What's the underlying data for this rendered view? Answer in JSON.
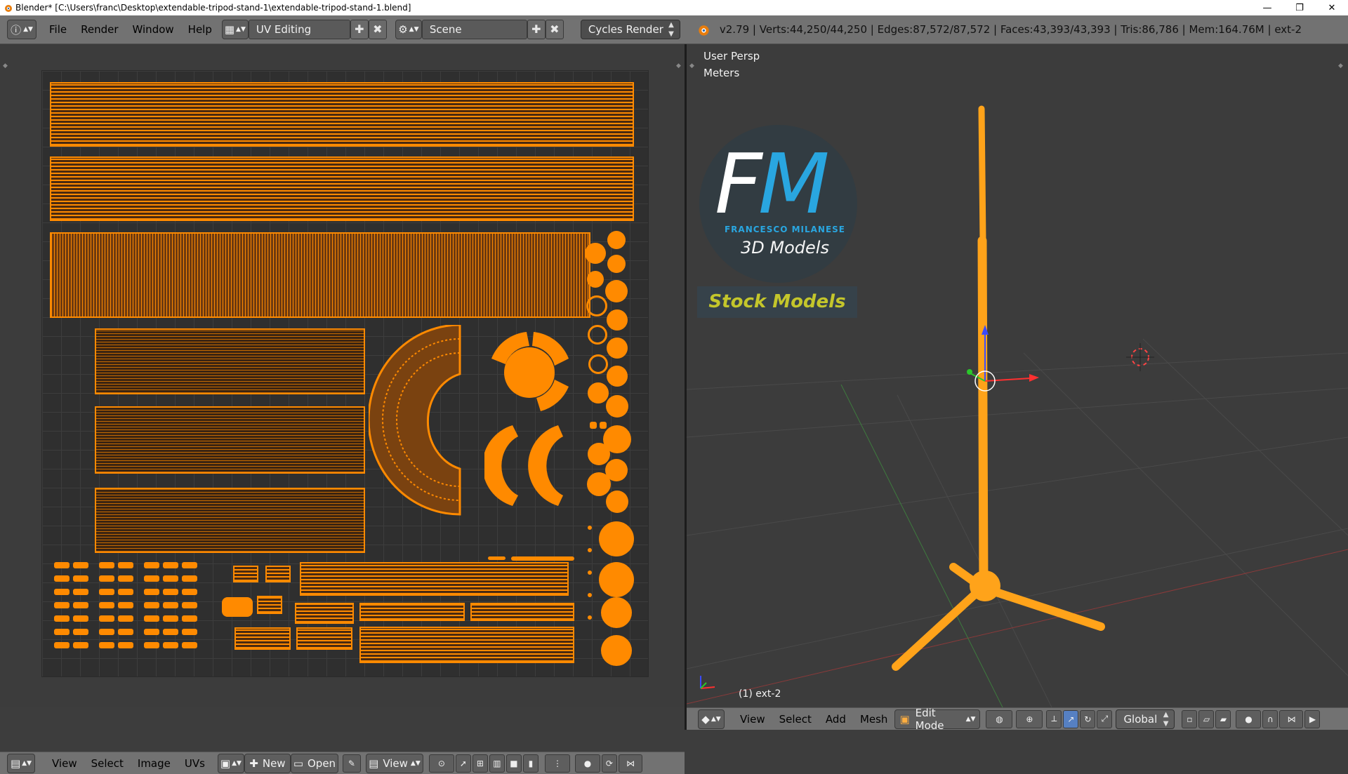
{
  "window": {
    "title": "Blender* [C:\\Users\\franc\\Desktop\\extendable-tripod-stand-1\\extendable-tripod-stand-1.blend]",
    "minimize": "—",
    "restore": "❐",
    "close": "✕"
  },
  "info_header": {
    "menus": [
      "File",
      "Render",
      "Window",
      "Help"
    ],
    "screen_layout": "UV Editing",
    "scene": "Scene",
    "render_engine": "Cycles Render",
    "stats": "v2.79 | Verts:44,250/44,250 | Edges:87,572/87,572 | Faces:43,393/43,393 | Tris:86,786 | Mem:164.76M | ext-2"
  },
  "uv_editor": {
    "header": {
      "menus": [
        "View",
        "Select",
        "Image",
        "UVs"
      ],
      "new_label": "New",
      "open_label": "Open",
      "view_label": "View"
    }
  },
  "viewport": {
    "view_name": "User Persp",
    "units": "Meters",
    "object_label": "(1) ext-2",
    "logo": {
      "letter_f": "F",
      "letter_m": "M",
      "name": "FRANCESCO MILANESE",
      "subtitle": "3D Models",
      "banner": "Stock Models"
    },
    "header": {
      "menus": [
        "View",
        "Select",
        "Add",
        "Mesh"
      ],
      "mode": "Edit Mode",
      "orientation": "Global"
    }
  },
  "colors": {
    "accent_orange": "#ff8a00",
    "header_gray": "#727272",
    "background": "#3c3c3c",
    "logo_blue": "#29a6e0",
    "logo_yellow": "#c4c62b"
  },
  "icons": [
    "blender-icon",
    "info-icon",
    "layout-icon",
    "scene-icon",
    "plus-icon",
    "close-icon",
    "image-icon",
    "cube-icon",
    "pin-icon",
    "cursor-icon"
  ]
}
